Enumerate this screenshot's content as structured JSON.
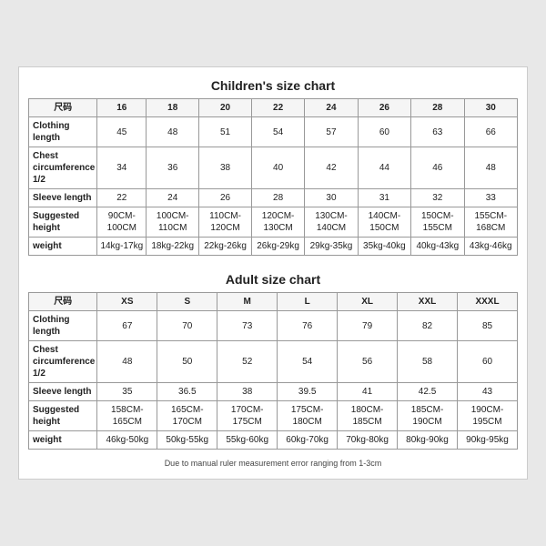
{
  "children": {
    "title": "Children's size chart",
    "headers": [
      "尺码",
      "16",
      "18",
      "20",
      "22",
      "24",
      "26",
      "28",
      "30"
    ],
    "rows": [
      {
        "label": "Clothing length",
        "values": [
          "45",
          "48",
          "51",
          "54",
          "57",
          "60",
          "63",
          "66"
        ]
      },
      {
        "label": "Chest circumference 1/2",
        "values": [
          "34",
          "36",
          "38",
          "40",
          "42",
          "44",
          "46",
          "48"
        ]
      },
      {
        "label": "Sleeve length",
        "values": [
          "22",
          "24",
          "26",
          "28",
          "30",
          "31",
          "32",
          "33"
        ]
      },
      {
        "label": "Suggested height",
        "values": [
          "90CM-100CM",
          "100CM-110CM",
          "110CM-120CM",
          "120CM-130CM",
          "130CM-140CM",
          "140CM-150CM",
          "150CM-155CM",
          "155CM-168CM"
        ]
      },
      {
        "label": "weight",
        "values": [
          "14kg-17kg",
          "18kg-22kg",
          "22kg-26kg",
          "26kg-29kg",
          "29kg-35kg",
          "35kg-40kg",
          "40kg-43kg",
          "43kg-46kg"
        ]
      }
    ]
  },
  "adult": {
    "title": "Adult size chart",
    "headers": [
      "尺码",
      "XS",
      "S",
      "M",
      "L",
      "XL",
      "XXL",
      "XXXL"
    ],
    "rows": [
      {
        "label": "Clothing length",
        "values": [
          "67",
          "70",
          "73",
          "76",
          "79",
          "82",
          "85"
        ]
      },
      {
        "label": "Chest circumference 1/2",
        "values": [
          "48",
          "50",
          "52",
          "54",
          "56",
          "58",
          "60"
        ]
      },
      {
        "label": "Sleeve length",
        "values": [
          "35",
          "36.5",
          "38",
          "39.5",
          "41",
          "42.5",
          "43"
        ]
      },
      {
        "label": "Suggested height",
        "values": [
          "158CM-165CM",
          "165CM-170CM",
          "170CM-175CM",
          "175CM-180CM",
          "180CM-185CM",
          "185CM-190CM",
          "190CM-195CM"
        ]
      },
      {
        "label": "weight",
        "values": [
          "46kg-50kg",
          "50kg-55kg",
          "55kg-60kg",
          "60kg-70kg",
          "70kg-80kg",
          "80kg-90kg",
          "90kg-95kg"
        ]
      }
    ]
  },
  "footer": "Due to manual ruler measurement error ranging from 1-3cm"
}
